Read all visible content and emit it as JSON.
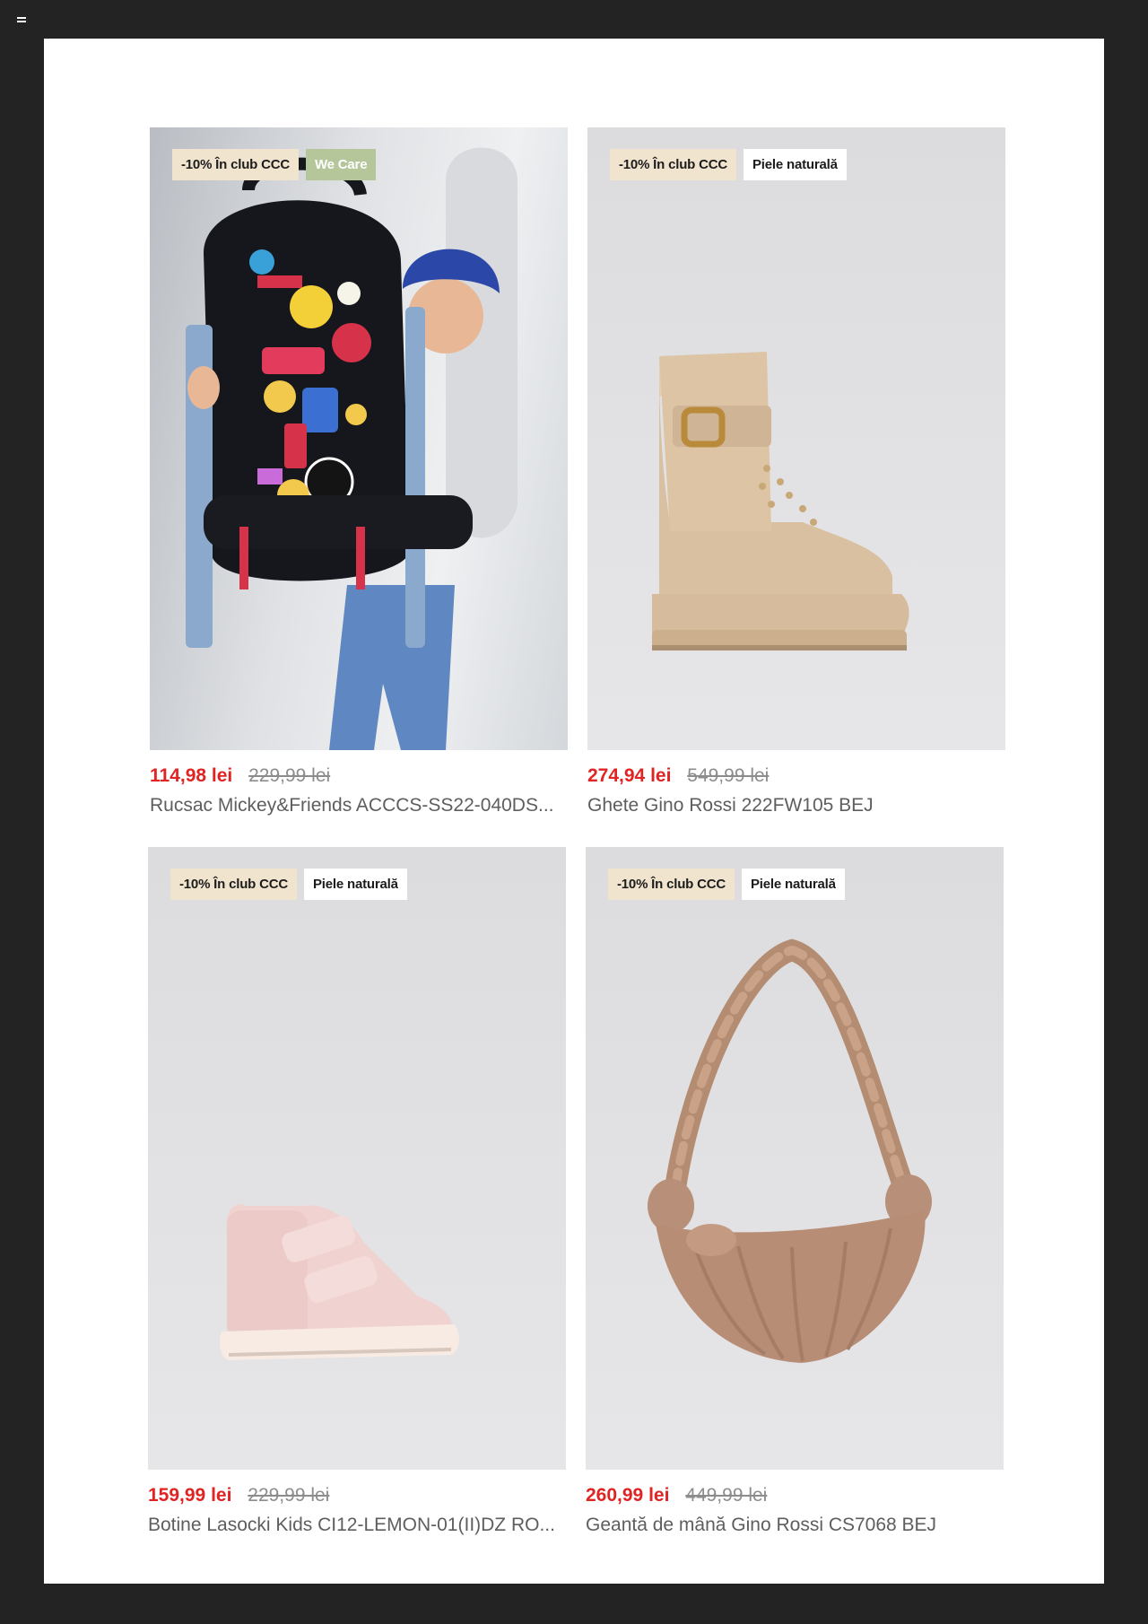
{
  "products": [
    {
      "badges": [
        "-10% În club CCC",
        "We Care"
      ],
      "price_new": "114,98 lei",
      "price_old": "229,99 lei",
      "name": "Rucsac Mickey&Friends ACCCS-SS22-040DS..."
    },
    {
      "badges": [
        "-10% În club CCC",
        "Piele naturală"
      ],
      "price_new": "274,94 lei",
      "price_old": "549,99 lei",
      "name": "Ghete Gino Rossi 222FW105 BEJ"
    },
    {
      "badges": [
        "-10% În club CCC",
        "Piele naturală"
      ],
      "price_new": "159,99 lei",
      "price_old": "229,99 lei",
      "name": "Botine Lasocki Kids CI12-LEMON-01(II)DZ RO..."
    },
    {
      "badges": [
        "-10% În club CCC",
        "Piele naturală"
      ],
      "price_new": "260,99 lei",
      "price_old": "449,99 lei",
      "name": "Geantă de mână Gino Rossi CS7068 BEJ"
    }
  ],
  "colors": {
    "price_new": "#e02424",
    "badge_club": "#f1e4cf",
    "badge_care": "#b5c69b",
    "frame": "#232323"
  },
  "icons": {
    "menu": "menu-icon"
  }
}
